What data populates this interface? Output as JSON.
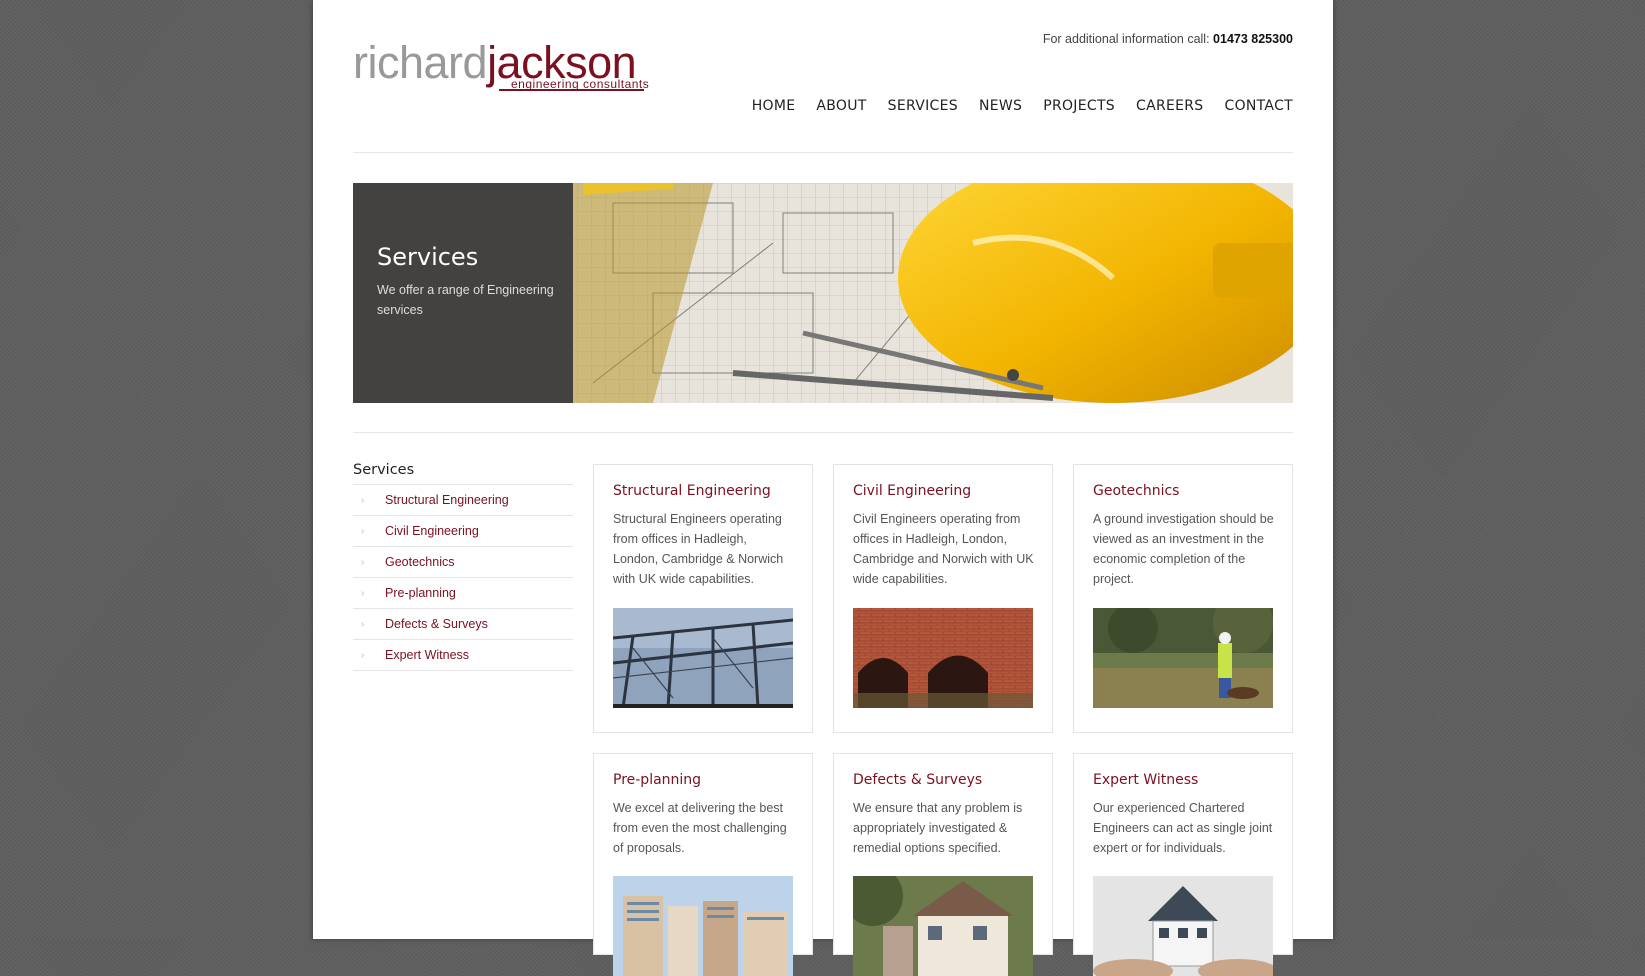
{
  "header": {
    "logo_part1": "richard",
    "logo_part2": "jackson",
    "logo_tagline": "engineering consultants",
    "call_text": "For additional information call:",
    "phone": "01473 825300"
  },
  "nav": {
    "items": [
      "HOME",
      "ABOUT",
      "SERVICES",
      "NEWS",
      "PROJECTS",
      "CAREERS",
      "CONTACT"
    ]
  },
  "banner": {
    "title": "Services",
    "subtitle": "We offer a range of Engineering services"
  },
  "sidebar": {
    "title": "Services",
    "items": [
      {
        "label": "Structural Engineering"
      },
      {
        "label": "Civil Engineering"
      },
      {
        "label": "Geotechnics"
      },
      {
        "label": "Pre-planning"
      },
      {
        "label": "Defects & Surveys"
      },
      {
        "label": "Expert Witness"
      }
    ]
  },
  "cards": [
    {
      "title": "Structural Engineering",
      "text": "Structural Engineers operating from offices in Hadleigh, London, Cambridge & Norwich with UK wide capabilities."
    },
    {
      "title": "Civil Engineering",
      "text": "Civil Engineers operating from offices in Hadleigh, London, Cambridge and Norwich with UK wide capabilities."
    },
    {
      "title": "Geotechnics",
      "text": "A ground investigation should be viewed as an investment in the economic completion of the project."
    },
    {
      "title": "Pre-planning",
      "text": "We excel at delivering the best from even the most challenging of proposals."
    },
    {
      "title": "Defects & Surveys",
      "text": "We ensure that any problem is appropriately investigated & remedial options specified."
    },
    {
      "title": "Expert Witness",
      "text": "Our experienced Chartered Engineers can act as single joint expert or for individuals."
    }
  ],
  "colors": {
    "brand": "#7a1020",
    "logo_grey": "#999999"
  }
}
